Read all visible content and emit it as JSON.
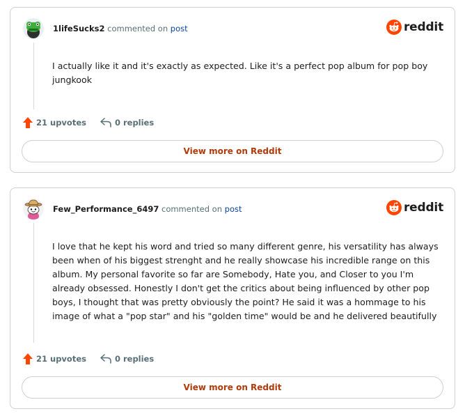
{
  "brand": {
    "wordmark": "reddit",
    "icon": "reddit-snoo-icon",
    "color": "#ff4500"
  },
  "comments": [
    {
      "username": "1lifeSucks2",
      "action_text": "commented on",
      "target_link": "post",
      "avatar_icon": "green-frog-avatar-icon",
      "body": "I actually like it and it's exactly as expected. Like it's a perfect pop album for pop boy jungkook",
      "upvotes": "21 upvotes",
      "replies": "0 replies",
      "cta": "View more on Reddit"
    },
    {
      "username": "Few_Performance_6497",
      "action_text": "commented on",
      "target_link": "post",
      "avatar_icon": "cowboy-hat-snoo-avatar-icon",
      "body": "I love that he kept his word and tried so many different genre, his versatility has always been when of his biggest strenght and he really showcase his incredible range on this album. My personal favorite so far are Somebody, Hate you, and Closer to you I'm already obsessed. Honestly I don't get the critics about being influenced by other pop boys, I thought that was pretty obviously the point? He said it was a hommage to his image of what a \"pop star\" and his \"golden time\" would be and he delivered beautifully",
      "upvotes": "21 upvotes",
      "replies": "0 replies",
      "cta": "View more on Reddit"
    }
  ],
  "colors": {
    "upvote": "#ff4500",
    "link": "#0a449b",
    "cta": "#b03a0a",
    "muted": "#576f76"
  }
}
